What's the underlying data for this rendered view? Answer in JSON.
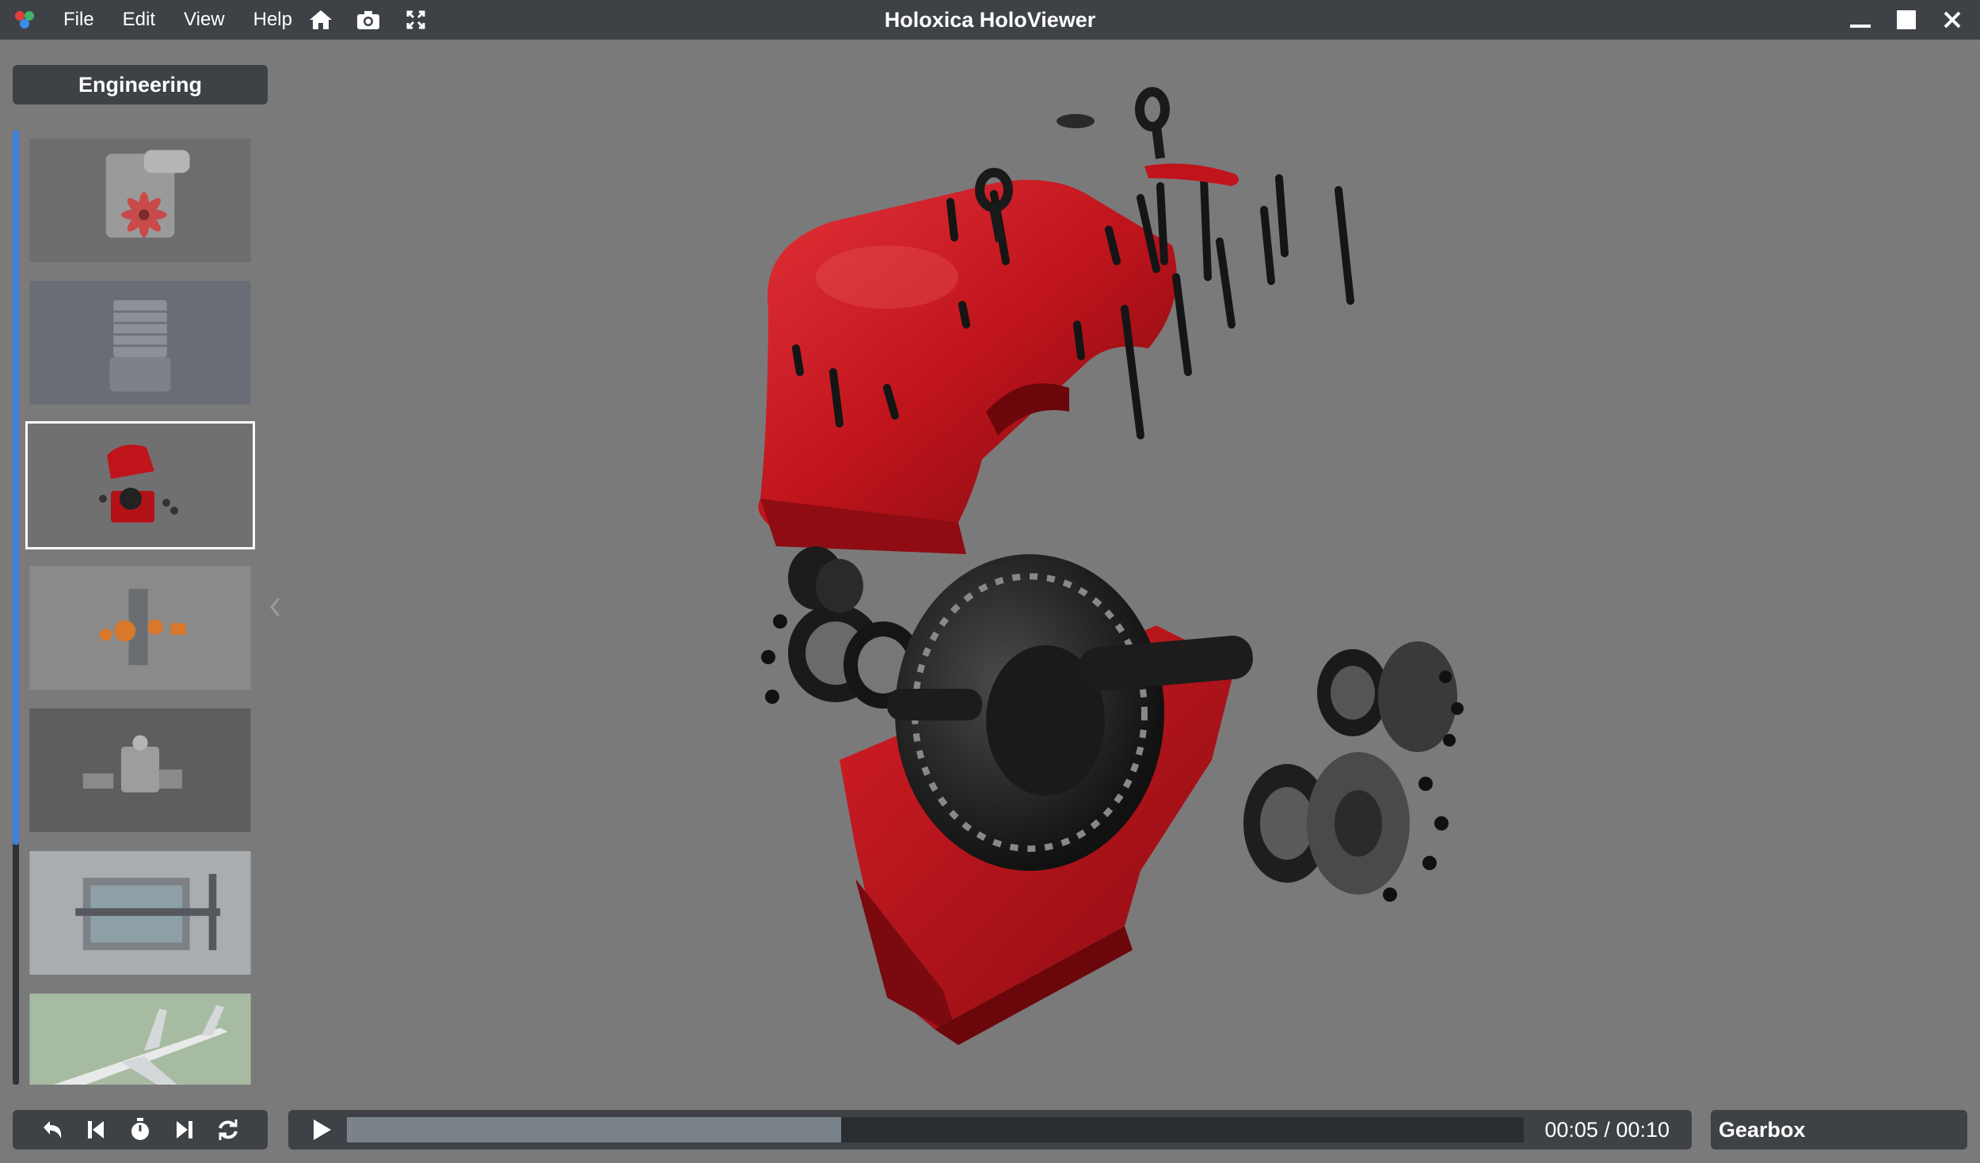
{
  "window": {
    "title": "Holoxica HoloViewer",
    "menu": [
      "File",
      "Edit",
      "View",
      "Help"
    ],
    "toolbar_icons": [
      "home-icon",
      "camera-icon",
      "fullscreen-icon"
    ],
    "controls": [
      "minimize-icon",
      "maximize-icon",
      "close-icon"
    ]
  },
  "sidebar": {
    "category": "Engineering",
    "scroll_position": 0.0,
    "thumbnails": [
      {
        "subject": "engine with red fan",
        "selected": false
      },
      {
        "subject": "cylinder block engine",
        "selected": false
      },
      {
        "subject": "exploded red gearbox",
        "selected": true
      },
      {
        "subject": "exploded orange assembly",
        "selected": false
      },
      {
        "subject": "mechanical assembly",
        "selected": false
      },
      {
        "subject": "cutaway machine",
        "selected": false
      },
      {
        "subject": "airliner",
        "selected": false
      }
    ],
    "collapse_icon": "chevron-left-icon"
  },
  "playback": {
    "buttons": [
      "undo-icon",
      "skip-back-icon",
      "stopwatch-icon",
      "skip-forward-icon",
      "refresh-icon"
    ],
    "play_icon": "play-icon",
    "progress": 0.42,
    "time": "00:05 / 00:10"
  },
  "model": {
    "name": "Gearbox"
  },
  "colors": {
    "titlebar": "#3e4246",
    "viewport": "#7a7a7a",
    "accent": "#3f7fe0",
    "gearbox_red": "#c0141c"
  }
}
